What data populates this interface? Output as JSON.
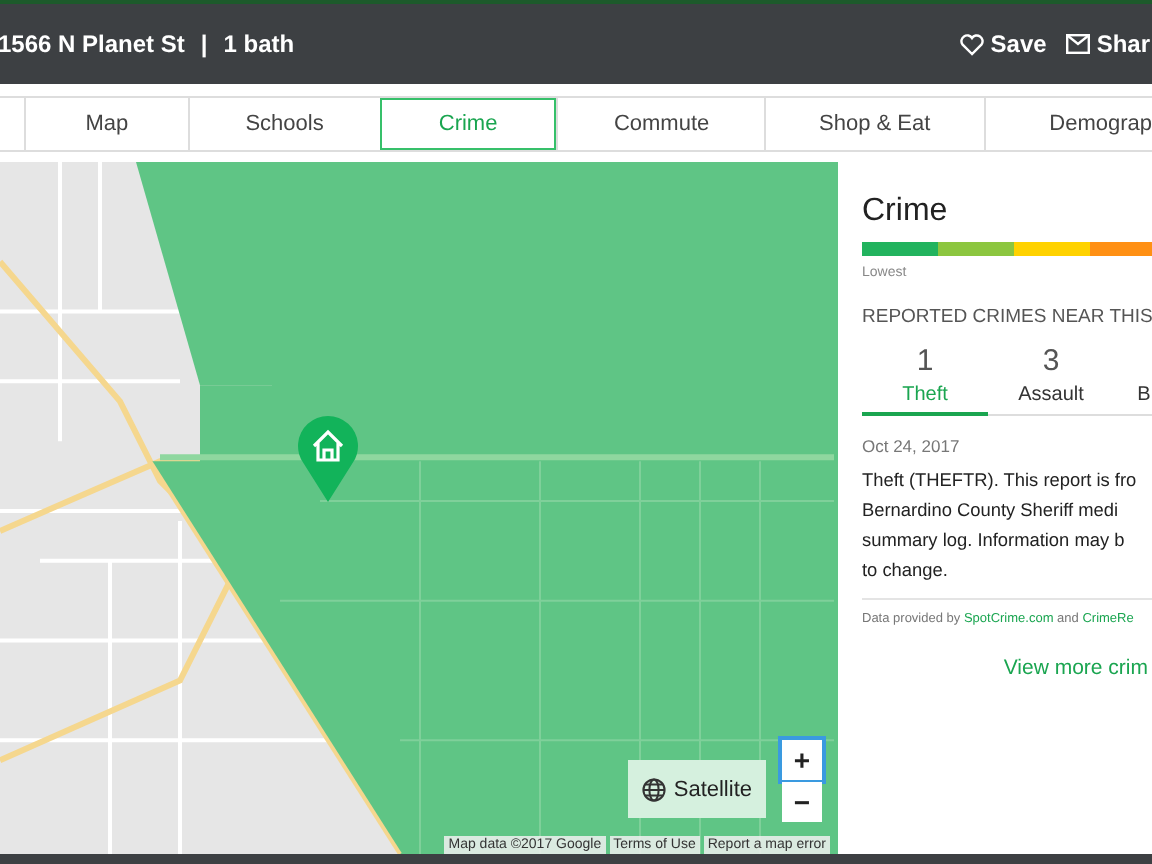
{
  "header": {
    "title": "1566 N Planet St",
    "separator": "|",
    "subtitle": "1 bath",
    "actions": [
      {
        "kind": "save",
        "label": "Save"
      },
      {
        "kind": "share",
        "label": "Shar"
      }
    ]
  },
  "tabs": [
    {
      "label": "Map",
      "selected": false
    },
    {
      "label": "Schools",
      "selected": false
    },
    {
      "label": "Crime",
      "selected": true
    },
    {
      "label": "Commute",
      "selected": false
    },
    {
      "label": "Shop & Eat",
      "selected": false
    },
    {
      "label": "Demograp",
      "selected": false
    }
  ],
  "map": {
    "satellite_label": "Satellite",
    "zoom_in": "+",
    "zoom_out": "−",
    "attribution": [
      "Map data ©2017 Google",
      "Terms of Use",
      "Report a map error"
    ]
  },
  "panel": {
    "title": "Crime",
    "scale": [
      {
        "color": "#22b35e"
      },
      {
        "color": "#8cc63f"
      },
      {
        "color": "#ffd200"
      },
      {
        "color": "#ff9014"
      }
    ],
    "scale_label": "Lowest",
    "section_title": "REPORTED CRIMES NEAR THIS",
    "crime_tabs": [
      {
        "count": "1",
        "label": "Theft",
        "selected": true
      },
      {
        "count": "3",
        "label": "Assault",
        "selected": false
      },
      {
        "label": "B",
        "selected": false
      }
    ],
    "report": {
      "date": "Oct 24, 2017",
      "lines": [
        "Theft (THEFTR). This report is fro",
        "Bernardino County Sheriff medi",
        "summary log. Information may b",
        "to change."
      ]
    },
    "source": {
      "prefix": "Data provided by",
      "link1": "SpotCrime.com",
      "middle": "and",
      "link2": "CrimeRe"
    },
    "more_link": "View more crim"
  }
}
